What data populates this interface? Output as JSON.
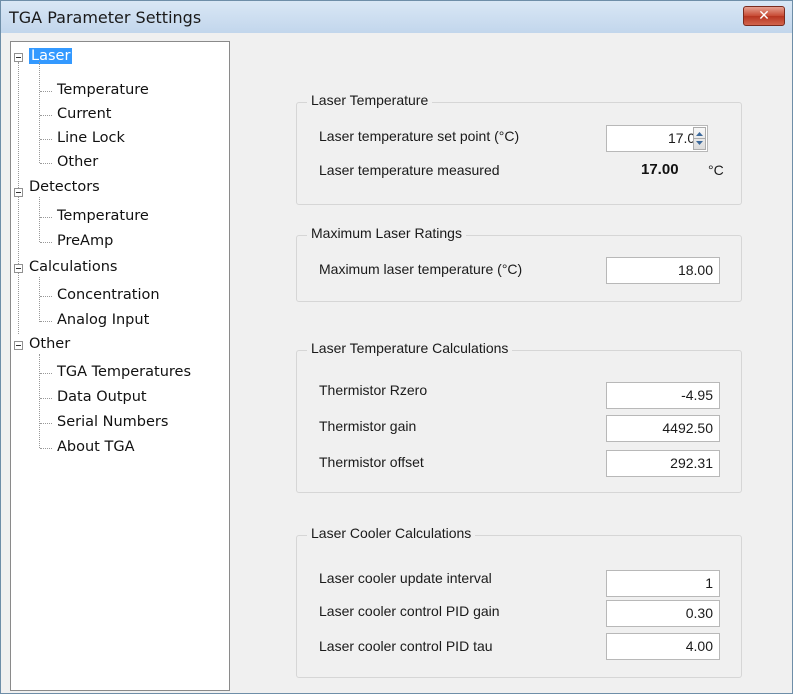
{
  "window": {
    "title": "TGA Parameter Settings",
    "close_glyph": "✕"
  },
  "tree": {
    "laser": {
      "label": "Laser",
      "children": [
        "Temperature",
        "Current",
        "Line Lock",
        "Other"
      ]
    },
    "detectors": {
      "label": "Detectors",
      "children": [
        "Temperature",
        "PreAmp"
      ]
    },
    "calculations": {
      "label": "Calculations",
      "children": [
        "Concentration",
        "Analog Input"
      ]
    },
    "other": {
      "label": "Other",
      "children": [
        "TGA Temperatures",
        "Data Output",
        "Serial Numbers",
        "About TGA"
      ]
    }
  },
  "laser_temperature": {
    "title": "Laser Temperature",
    "setpoint_label": "Laser temperature set point (°C)",
    "setpoint_value": "17.00",
    "measured_label": "Laser temperature measured",
    "measured_value": "17.00",
    "measured_unit": "°C"
  },
  "max_ratings": {
    "title": "Maximum Laser Ratings",
    "max_temp_label": "Maximum laser temperature (°C)",
    "max_temp_value": "18.00"
  },
  "temp_calcs": {
    "title": "Laser Temperature Calculations",
    "rzero_label": "Thermistor Rzero",
    "rzero_value": "-4.95",
    "gain_label": "Thermistor gain",
    "gain_value": "4492.50",
    "offset_label": "Thermistor offset",
    "offset_value": "292.31"
  },
  "cooler_calcs": {
    "title": "Laser Cooler Calculations",
    "interval_label": "Laser cooler update interval",
    "interval_value": "1",
    "pid_gain_label": "Laser cooler control PID gain",
    "pid_gain_value": "0.30",
    "pid_tau_label": "Laser cooler control PID tau",
    "pid_tau_value": "4.00"
  },
  "icons": {
    "expander": "minus-box-icon",
    "spin": "spin-arrows-icon"
  }
}
